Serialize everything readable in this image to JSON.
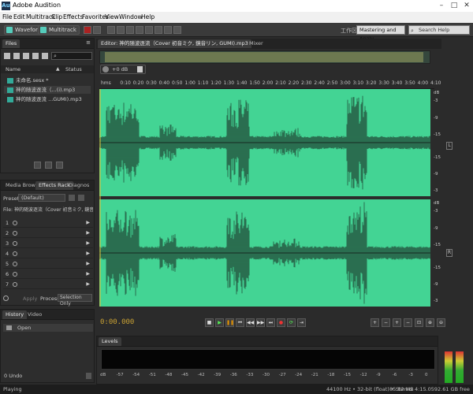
{
  "window": {
    "title": "Adobe Audition",
    "app_icon": "Au",
    "minimize": "–",
    "maximize": "□",
    "close": "✕"
  },
  "menu": [
    "File",
    "Edit",
    "Multitrack",
    "Clip",
    "Effects",
    "Favorites",
    "View",
    "Window",
    "Help"
  ],
  "toolbar": {
    "waveform_label": "Waveform",
    "multitrack_label": "Multitrack",
    "workspace_label": "工作区:",
    "workspace_value": "Mastering and Analy...",
    "search_placeholder": "Search Help"
  },
  "files_panel": {
    "tab": "Files",
    "col_name": "Name",
    "col_status": "Status",
    "items": [
      {
        "name": "未命名.sesx *"
      },
      {
        "name": "神的随波逐流（...(i).mp3"
      },
      {
        "name": "神的随波逐流 ...GUMI).mp3"
      }
    ]
  },
  "effects_panel": {
    "tabs": [
      "Media Browser",
      "Effects Rack",
      "Diagnos"
    ],
    "presets_label": "Presets:",
    "presets_value": "(Default)",
    "file_label": "File: 神的随波逐流（Cover 初音ミク, 鏡音リン, GUMI).mp3",
    "slots": [
      "1",
      "2",
      "3",
      "4",
      "5",
      "6",
      "7"
    ],
    "apply": "Apply",
    "process_label": "Process:",
    "process_value": "Selection Only"
  },
  "history_panel": {
    "tabs": [
      "History",
      "Video"
    ],
    "items": [
      "Open"
    ],
    "undo": "0 Undo"
  },
  "editor": {
    "tab_editor": "Editor: 神的随波逐流（Cover 初音ミク, 鏡音リン, GUMI).mp3",
    "tab_mixer": "Mixer",
    "gain": "+0 dB",
    "ruler": [
      "hms",
      "0:10",
      "0:20",
      "0:30",
      "0:40",
      "0:50",
      "1:00",
      "1:10",
      "1:20",
      "1:30",
      "1:40",
      "1:50",
      "2:00",
      "2:10",
      "2:20",
      "2:30",
      "2:40",
      "2:50",
      "3:00",
      "3:10",
      "3:20",
      "3:30",
      "3:40",
      "3:50",
      "4:00",
      "4:10"
    ],
    "db_labels": [
      "dB",
      "-3",
      "-9",
      "-15",
      "-15",
      "-9",
      "-3",
      "dB",
      "-3",
      "-9",
      "-15",
      "-15",
      "-9",
      "-3"
    ],
    "channels": [
      "L",
      "R"
    ],
    "timecode": "0:00.000",
    "wave_color": "#43d494"
  },
  "levels": {
    "tab": "Levels",
    "scale": [
      "dB",
      "-57",
      "-54",
      "-51",
      "-48",
      "-45",
      "-42",
      "-39",
      "-36",
      "-33",
      "-30",
      "-27",
      "-24",
      "-21",
      "-18",
      "-15",
      "-12",
      "-9",
      "-6",
      "-3",
      "0"
    ]
  },
  "status": {
    "left": "Playing",
    "sample": "44100 Hz • 32-bit (float) • Stereo",
    "size": "85.82 MB",
    "duration": "4:15.059",
    "free": "2.61 GB free"
  }
}
